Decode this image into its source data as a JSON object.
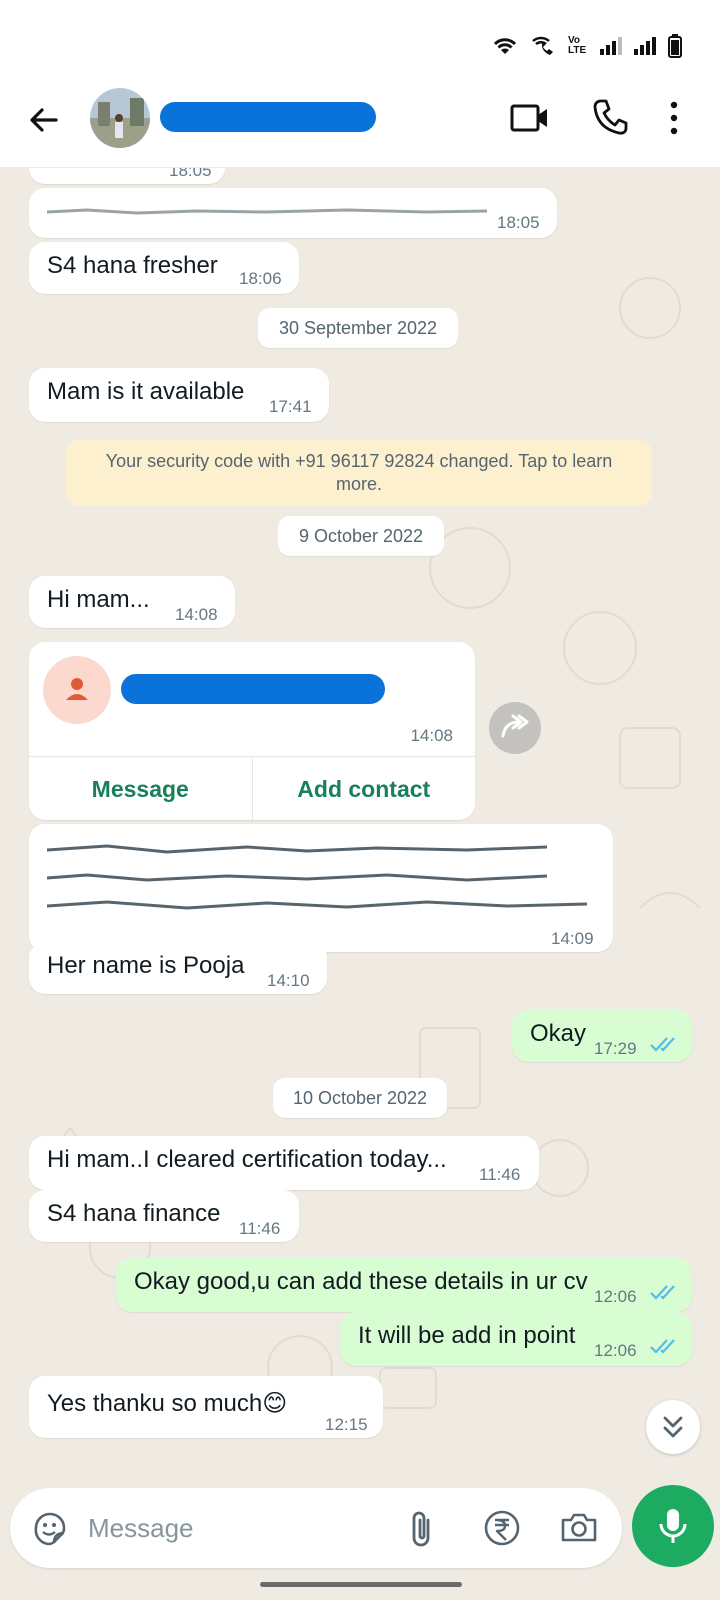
{
  "statusbar": {
    "icons": [
      "wifi-icon",
      "wifi-call-icon",
      "volte-icon",
      "signal-icon",
      "signal-icon-2",
      "battery-icon"
    ],
    "volte_label": "Vo LTE"
  },
  "header": {
    "contact_name": "",
    "icons": [
      "back-arrow-icon",
      "video-call-icon",
      "voice-call-icon",
      "more-vert-icon"
    ]
  },
  "messages": [
    {
      "dir": "in",
      "text": "",
      "time": "18:05"
    },
    {
      "dir": "in",
      "text": "",
      "time": "18:05"
    },
    {
      "dir": "in",
      "text": "S4 hana fresher",
      "time": "18:06"
    },
    {
      "type": "date",
      "text": "30 September 2022"
    },
    {
      "dir": "in",
      "text": "Mam is it available",
      "time": "17:41"
    },
    {
      "type": "system",
      "text": "Your security code with +91 96117 92824 changed. Tap to learn more."
    },
    {
      "type": "date",
      "text": "9 October 2022"
    },
    {
      "dir": "in",
      "text": "Hi mam...",
      "time": "14:08"
    },
    {
      "type": "contact_card",
      "time": "14:08",
      "actions": [
        "Message",
        "Add contact"
      ]
    },
    {
      "dir": "in",
      "text": "",
      "time": "14:09"
    },
    {
      "dir": "in",
      "text": "Her name is Pooja",
      "time": "14:10"
    },
    {
      "dir": "out",
      "text": "Okay",
      "time": "17:29",
      "status": "read"
    },
    {
      "type": "date",
      "text": "10 October 2022"
    },
    {
      "dir": "in",
      "text": "Hi mam..I cleared certification today...",
      "time": "11:46"
    },
    {
      "dir": "in",
      "text": "S4 hana finance",
      "time": "11:46"
    },
    {
      "dir": "out",
      "text": "Okay good,u can add these details in ur cv",
      "time": "12:06",
      "status": "read"
    },
    {
      "dir": "out",
      "text": "It will be add in point",
      "time": "12:06",
      "status": "read"
    },
    {
      "dir": "in",
      "text": "Yes thanku so much😊",
      "time": "12:15"
    }
  ],
  "composer": {
    "placeholder": "Message",
    "icons": [
      "sticker-icon",
      "attach-icon",
      "rupee-payment-icon",
      "camera-icon",
      "mic-icon"
    ]
  },
  "colors": {
    "outgoing_bubble": "#d9fdd3",
    "incoming_bubble": "#ffffff",
    "chat_background": "#efeae2",
    "accent_green": "#1daa61",
    "read_ticks": "#53bdeb",
    "system_chip": "#fdf0cf"
  }
}
